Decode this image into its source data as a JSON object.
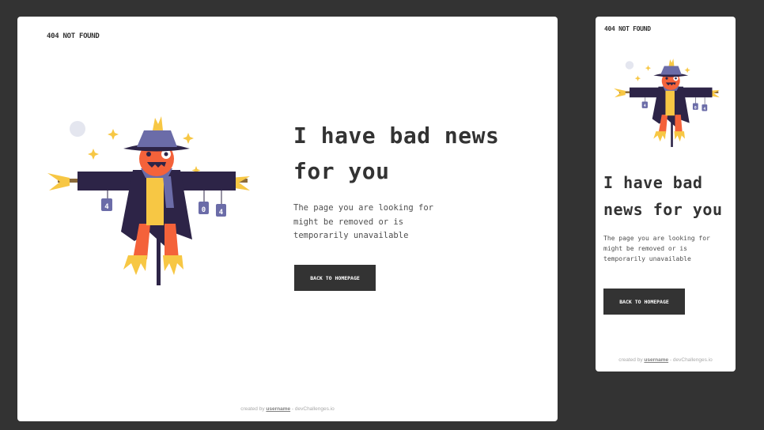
{
  "brand": "404 NOT FOUND",
  "headline": "I have bad news for you",
  "description": "The page you are looking for might be removed or is temporarily unavailable",
  "cta_label": "BACK TO HOMEPAGE",
  "footer": {
    "prefix": "created by",
    "username": "username",
    "suffix": "- devChallenges.io"
  },
  "sign_digits": [
    "4",
    "0",
    "4"
  ],
  "colors": {
    "page_bg": "#333333",
    "card_bg": "#FFFFFF",
    "text_dark": "#333333",
    "coat": "#2D2447",
    "face": "#F4623A",
    "straw": "#F7C744",
    "sign": "#6B6CA8"
  }
}
